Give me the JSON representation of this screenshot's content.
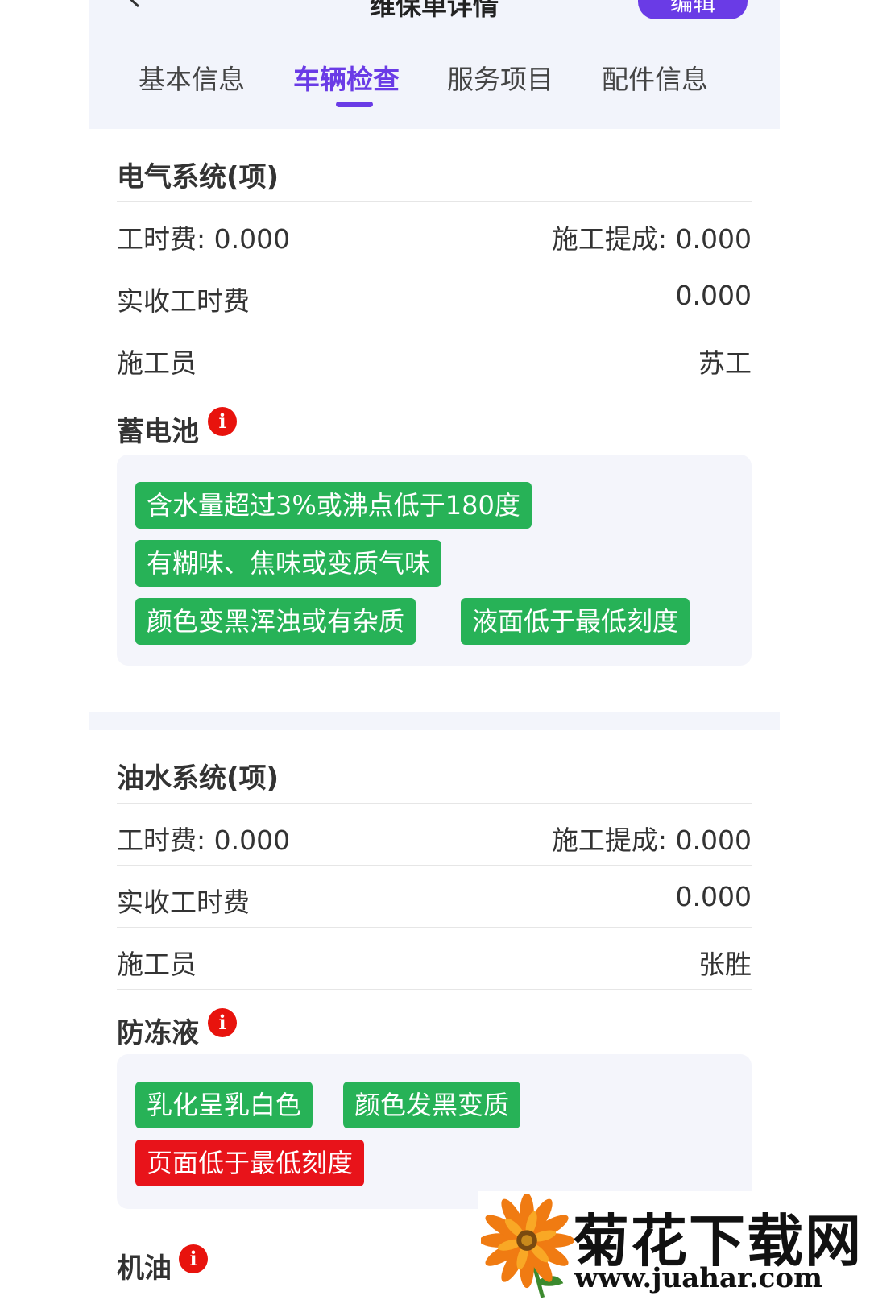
{
  "header": {
    "title": "维保单详情",
    "edit_label": "编辑",
    "tabs": [
      "基本信息",
      "车辆检查",
      "服务项目",
      "配件信息"
    ],
    "active_tab": "车辆检查"
  },
  "sections": [
    {
      "title": "电气系统(项)",
      "labor_fee_label": "工时费: 0.000",
      "commission_label": "施工提成: 0.000",
      "actual_labor_label": "实收工时费",
      "actual_labor_value": "0.000",
      "worker_label": "施工员",
      "worker_value": "苏工",
      "item": {
        "title": "蓄电池",
        "tags": [
          "含水量超过3%或沸点低于180度",
          "有糊味、焦味或变质气味",
          "颜色变黑浑浊或有杂质",
          "液面低于最低刻度"
        ]
      }
    },
    {
      "title": "油水系统(项)",
      "labor_fee_label": "工时费: 0.000",
      "commission_label": "施工提成: 0.000",
      "actual_labor_label": "实收工时费",
      "actual_labor_value": "0.000",
      "worker_label": "施工员",
      "worker_value": "张胜",
      "item": {
        "title": "防冻液",
        "tags": [
          "乳化呈乳白色",
          "颜色发黑变质",
          "页面低于最低刻度"
        ]
      },
      "next_item_title": "机油"
    }
  ],
  "colors": {
    "accent": "#6a3be6",
    "tag_ok": "#27b257",
    "tag_alert": "#e8131a",
    "info_icon": "#e8130d"
  },
  "watermark": {
    "title": "菊花下载网",
    "url": "www.juahar.com"
  }
}
